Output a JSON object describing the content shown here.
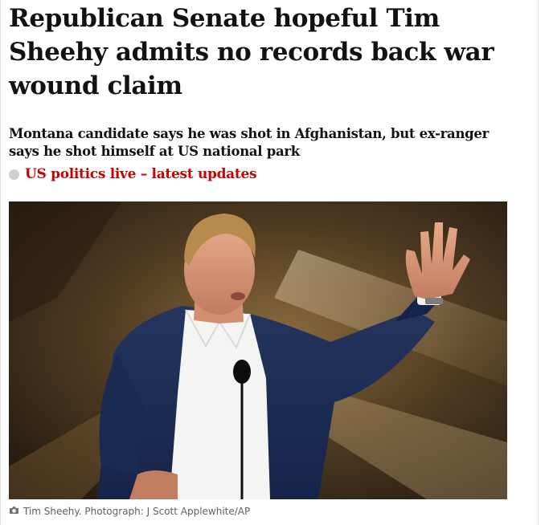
{
  "article": {
    "headline": "Republican Senate hopeful Tim Sheehy admits no records back war wound claim",
    "standfirst": "Montana candidate says he was shot in Afghanistan, but ex-ranger says he shot himself at US national park",
    "live_link_label": "US politics live – latest updates",
    "image_alt": "Tim Sheehy speaking at a podium, raising his left hand",
    "caption": "Tim Sheehy. Photograph: J Scott Applewhite/AP"
  },
  "colors": {
    "text": "#121212",
    "live_link": "#c70000",
    "caption": "#606060",
    "dot": "#cfcfcf"
  },
  "icons": {
    "live": "live-dot-icon",
    "caption": "camera-icon"
  }
}
